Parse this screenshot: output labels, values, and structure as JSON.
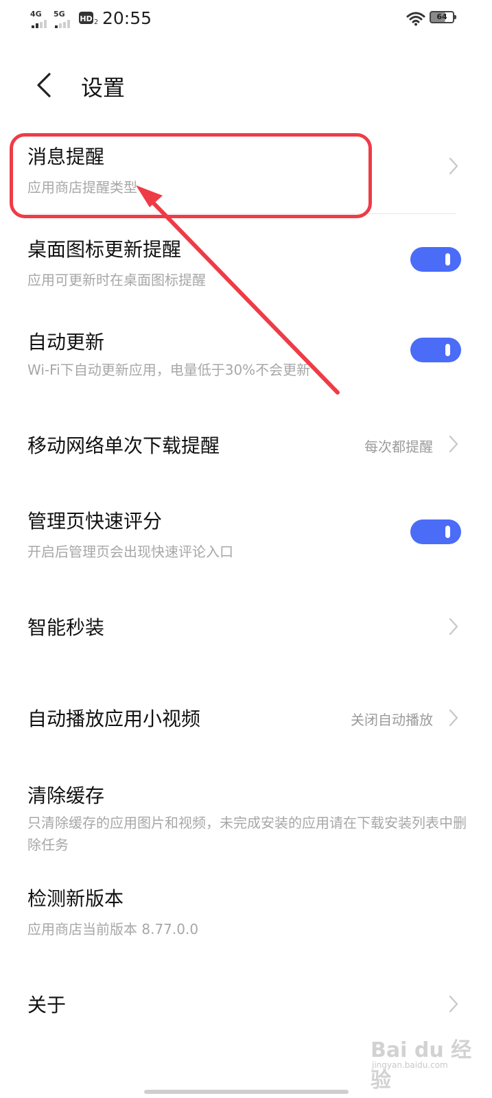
{
  "status_bar": {
    "signal1_label": "4G",
    "signal2_label": "5G",
    "hd_label": "HD",
    "hd_sub": "2",
    "time": "20:55",
    "battery": "64"
  },
  "header": {
    "back_icon": "chevron-left-icon",
    "title": "设置"
  },
  "settings": [
    {
      "id": "message",
      "title": "消息提醒",
      "subtitle": "应用商店提醒类型",
      "control": "chevron"
    },
    {
      "id": "desktop-icon-update",
      "title": "桌面图标更新提醒",
      "subtitle": "应用可更新时在桌面图标提醒",
      "control": "toggle",
      "on": true
    },
    {
      "id": "auto-update",
      "title": "自动更新",
      "subtitle": "Wi-Fi下自动更新应用，电量低于30%不会更新",
      "control": "toggle",
      "on": true
    },
    {
      "id": "mobile-download",
      "title": "移动网络单次下载提醒",
      "value": "每次都提醒",
      "control": "chevron"
    },
    {
      "id": "quick-rating",
      "title": "管理页快速评分",
      "subtitle": "开启后管理页会出现快速评论入口",
      "control": "toggle",
      "on": true
    },
    {
      "id": "smart-install",
      "title": "智能秒装",
      "control": "chevron"
    },
    {
      "id": "autoplay-video",
      "title": "自动播放应用小视频",
      "value": "关闭自动播放",
      "control": "chevron"
    },
    {
      "id": "clear-cache",
      "title": "清除缓存",
      "subtitle": "只清除缓存的应用图片和视频，未完成安装的应用请在下载安装列表中删除任务"
    },
    {
      "id": "check-version",
      "title": "检测新版本",
      "subtitle": "应用商店当前版本 8.77.0.0"
    },
    {
      "id": "about",
      "title": "关于",
      "control": "chevron"
    }
  ],
  "annotation": {
    "color": "#ee3c47"
  },
  "toggle_color": "#4a6cf7",
  "watermark": {
    "text": "Bai du 经验",
    "url": "jingyan.baidu.com"
  }
}
